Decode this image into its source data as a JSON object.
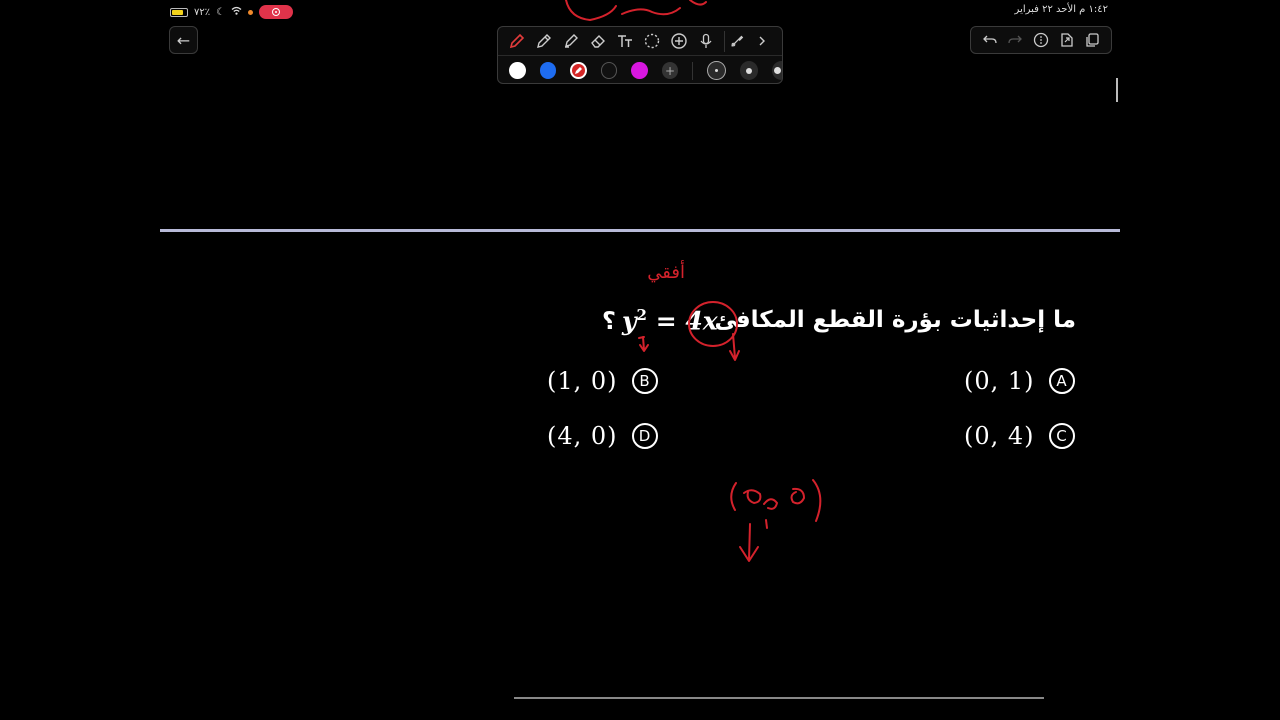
{
  "status_bar": {
    "battery_text": "٧٢٪",
    "datetime": "١:٤٢ م  الأحد ٢٢ فبراير"
  },
  "question": {
    "text": "ما إحداثيات بؤرة القطع المكافئ",
    "equation_lhs": "y",
    "equation_power": "2",
    "equation_rhs": "= 4x",
    "question_mark": "؟"
  },
  "options": [
    {
      "letter": "A",
      "value": "(0, 1)"
    },
    {
      "letter": "B",
      "value": "(1, 0)"
    },
    {
      "letter": "C",
      "value": "(0, 4)"
    },
    {
      "letter": "D",
      "value": "(4, 0)"
    }
  ],
  "annotations": {
    "ink_color": "#d4222c",
    "label_horizontal": "أفقي",
    "label_focus": "(ﻫ ، ٠)"
  },
  "toolbar": {
    "tools": [
      "pen-icon",
      "pencil-icon",
      "highlighter-icon",
      "eraser-icon",
      "text-icon",
      "lasso-icon",
      "add-icon",
      "microphone-icon",
      "laser-pointer-icon",
      "chevron-right-icon"
    ],
    "active_tool": "pen-icon",
    "colors": [
      "#ffffff",
      "#1e6cf0",
      "#d42727",
      "#111111",
      "#d817e0"
    ],
    "selected_color": "#d42727"
  },
  "top_right": {
    "icons": [
      "undo-icon",
      "redo-icon",
      "more-icon",
      "export-icon",
      "copy-icon"
    ]
  }
}
